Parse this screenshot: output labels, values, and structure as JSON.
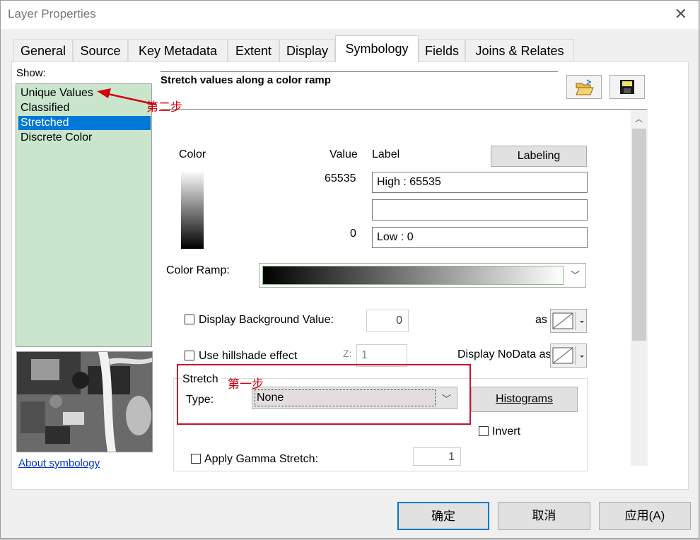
{
  "window": {
    "title": "Layer Properties",
    "close_glyph": "✕"
  },
  "tabs": [
    {
      "label": "General"
    },
    {
      "label": "Source"
    },
    {
      "label": "Key Metadata"
    },
    {
      "label": "Extent"
    },
    {
      "label": "Display"
    },
    {
      "label": "Symbology",
      "active": true
    },
    {
      "label": "Fields"
    },
    {
      "label": "Joins & Relates"
    }
  ],
  "show": {
    "label": "Show:",
    "items": [
      {
        "label": "Unique Values"
      },
      {
        "label": "Classified"
      },
      {
        "label": "Stretched",
        "selected": true
      },
      {
        "label": "Discrete Color"
      }
    ],
    "about_link": "About symbology"
  },
  "symbology": {
    "description": "Stretch values along a color ramp",
    "columns": {
      "color": "Color",
      "value": "Value",
      "label": "Label"
    },
    "labeling_button": "Labeling",
    "high_value": "65535",
    "high_label": "High : 65535",
    "mid_label": "",
    "low_value": "0",
    "low_label": "Low : 0",
    "color_ramp_label": "Color Ramp:",
    "display_background_label": "Display Background Value:",
    "background_value": "0",
    "as_label": "as",
    "hillshade_label": "Use hillshade effect",
    "z_label": "Z:",
    "z_value": "1",
    "nodata_label": "Display NoData as",
    "stretch_group": "Stretch",
    "type_label": "Type:",
    "type_value": "None",
    "histograms_button": "Histograms",
    "invert_label": "Invert",
    "gamma_label": "Apply Gamma Stretch:",
    "gamma_value": "1"
  },
  "annotations": {
    "step1": "第一步",
    "step2": "第二步"
  },
  "footer": {
    "ok": "确定",
    "cancel": "取消",
    "apply": "应用(A)"
  },
  "colors": {
    "accent": "#0078d7",
    "annotation": "#d4000f",
    "show_list_bg": "#c9e6cc"
  }
}
